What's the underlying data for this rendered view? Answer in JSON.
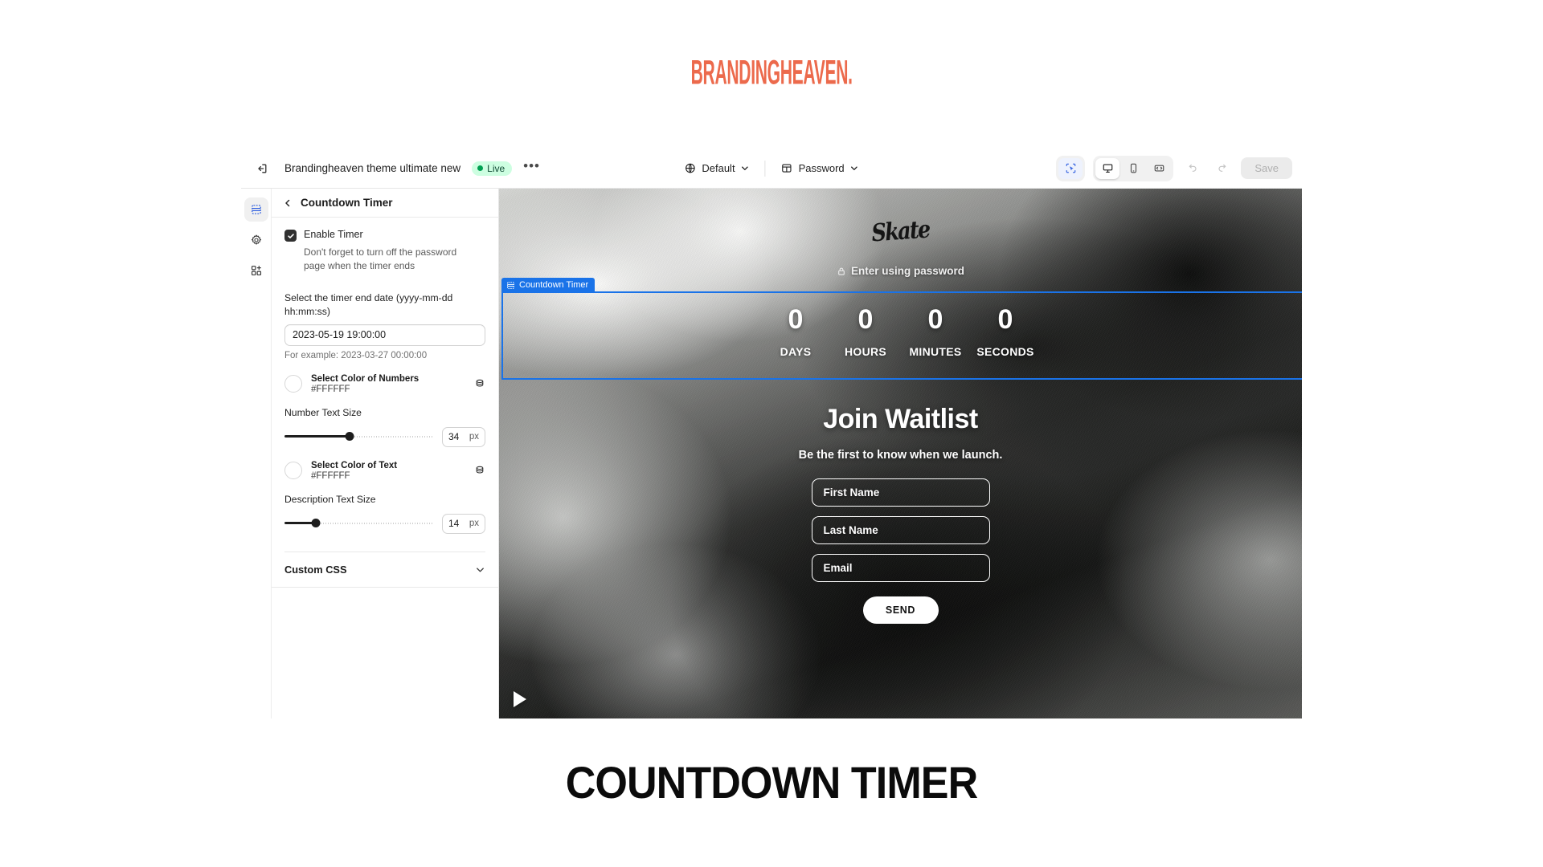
{
  "brand": {
    "logo_text": "BRANDINGHEAVEN.",
    "logo_color": "#ec6a4c"
  },
  "caption": "COUNTDOWN TIMER",
  "topbar": {
    "exit_icon": "exit-icon",
    "theme_name": "Brandingheaven theme ultimate new",
    "status_badge": "Live",
    "more_label": "•••",
    "left_dropdown": {
      "icon": "globe-icon",
      "label": "Default"
    },
    "right_dropdown": {
      "icon": "page-icon",
      "label": "Password"
    },
    "view_buttons": [
      {
        "name": "select-tool",
        "icon": "cursor-select-icon",
        "state": "active-blue"
      },
      {
        "name": "desktop-view",
        "icon": "desktop-icon",
        "state": "active-white"
      },
      {
        "name": "mobile-view",
        "icon": "mobile-icon",
        "state": "default"
      },
      {
        "name": "fullwidth-view",
        "icon": "fullwidth-icon",
        "state": "default"
      }
    ],
    "undo_icon": "undo-icon",
    "redo_icon": "redo-icon",
    "save_label": "Save"
  },
  "rail": [
    {
      "name": "sections",
      "icon": "sections-icon",
      "active": true
    },
    {
      "name": "theme-settings",
      "icon": "gear-icon",
      "active": false
    },
    {
      "name": "app-embeds",
      "icon": "apps-add-icon",
      "active": false
    }
  ],
  "panel": {
    "back_icon": "chevron-left-icon",
    "title": "Countdown Timer",
    "enable_timer": {
      "label": "Enable Timer",
      "checked": true,
      "help": "Don't forget to turn off the password page when the timer ends"
    },
    "date_field": {
      "label": "Select the timer end date (yyyy-mm-dd hh:mm:ss)",
      "value": "2023-05-19 19:00:00",
      "placeholder": "yyyy-mm-dd hh:mm:ss",
      "hint": "For example: 2023-03-27 00:00:00"
    },
    "color_numbers": {
      "label": "Select Color of Numbers",
      "hex": "#FFFFFF",
      "swatch_icon": "color-swatch-icon",
      "picker_icon": "color-library-icon"
    },
    "number_size": {
      "label": "Number Text Size",
      "value": "34",
      "unit": "px",
      "percent": 44
    },
    "color_text": {
      "label": "Select Color of Text",
      "hex": "#FFFFFF",
      "swatch_icon": "color-swatch-icon",
      "picker_icon": "color-library-icon"
    },
    "description_size": {
      "label": "Description Text Size",
      "value": "14",
      "unit": "px",
      "percent": 21
    },
    "custom_css": {
      "title": "Custom CSS",
      "chevron": "chevron-down-icon"
    }
  },
  "preview": {
    "site_logo": "Skate",
    "enter_password": "Enter using password",
    "lock_icon": "lock-icon",
    "selection_tag": "Countdown Timer",
    "countdown": [
      {
        "value": "0",
        "label": "DAYS"
      },
      {
        "value": "0",
        "label": "HOURS"
      },
      {
        "value": "0",
        "label": "MINUTES"
      },
      {
        "value": "0",
        "label": "SECONDS"
      }
    ],
    "waitlist": {
      "title": "Join Waitlist",
      "subtitle": "Be the first to know when we launch.",
      "fields": [
        {
          "name": "first-name-input",
          "placeholder": "First Name",
          "value": ""
        },
        {
          "name": "last-name-input",
          "placeholder": "Last Name",
          "value": ""
        },
        {
          "name": "email-input",
          "placeholder": "Email",
          "value": ""
        }
      ],
      "send_label": "SEND"
    },
    "play_icon": "play-icon"
  }
}
